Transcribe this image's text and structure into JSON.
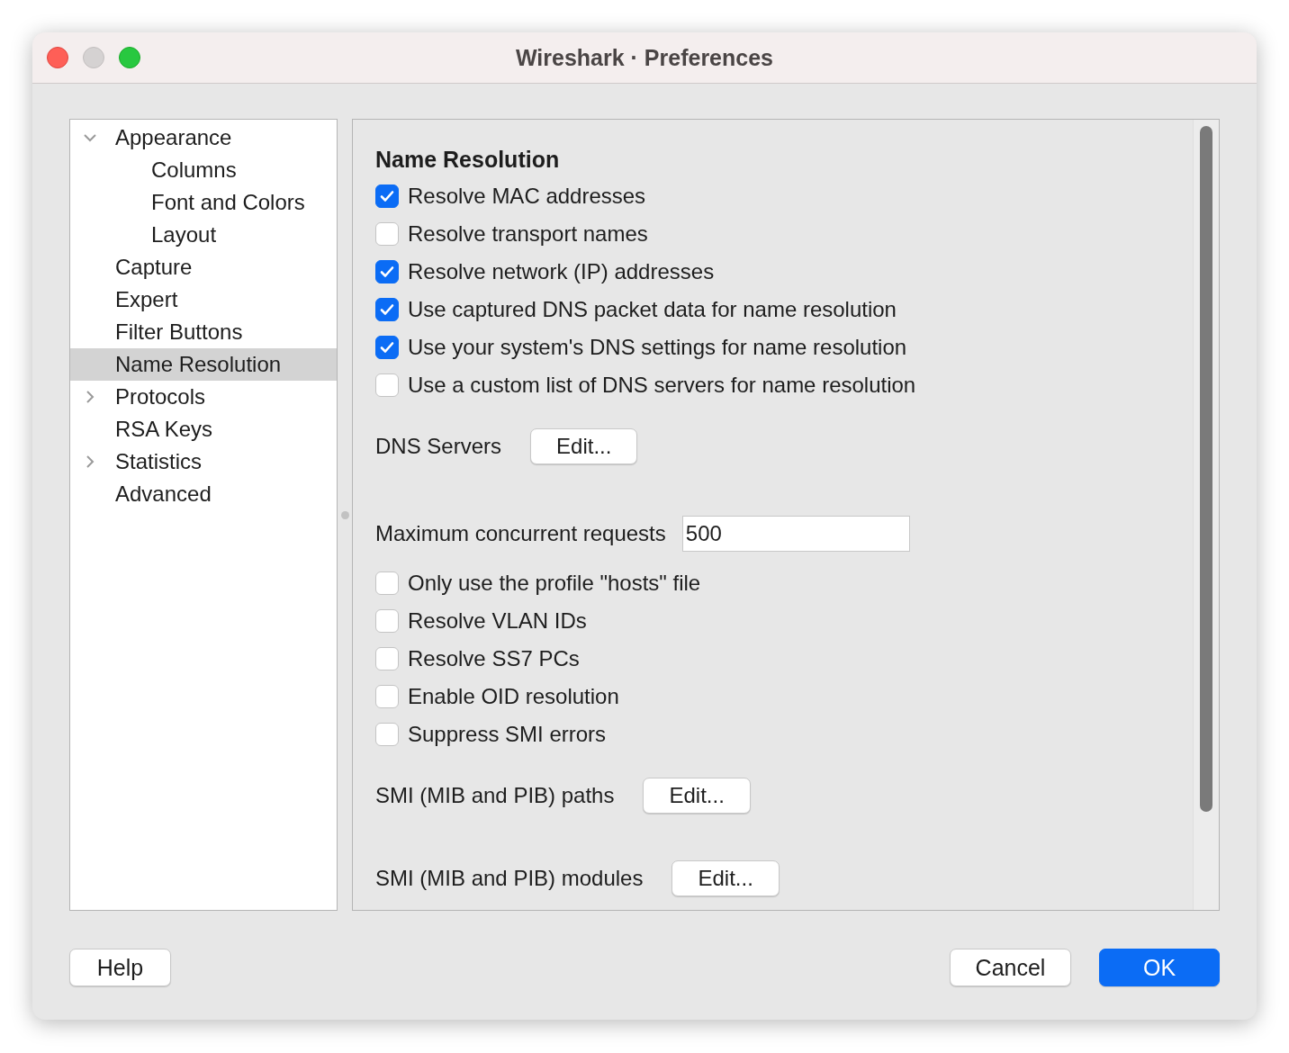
{
  "window": {
    "title": "Wireshark · Preferences"
  },
  "tree": [
    {
      "label": "Appearance",
      "selected": false,
      "expanded": true,
      "children": [
        {
          "label": "Columns",
          "selected": false
        },
        {
          "label": "Font and Colors",
          "selected": false
        },
        {
          "label": "Layout",
          "selected": false
        }
      ]
    },
    {
      "label": "Capture",
      "selected": false
    },
    {
      "label": "Expert",
      "selected": false
    },
    {
      "label": "Filter Buttons",
      "selected": false
    },
    {
      "label": "Name Resolution",
      "selected": true
    },
    {
      "label": "Protocols",
      "selected": false,
      "expanded": false
    },
    {
      "label": "RSA Keys",
      "selected": false
    },
    {
      "label": "Statistics",
      "selected": false,
      "expanded": false
    },
    {
      "label": "Advanced",
      "selected": false
    }
  ],
  "panel": {
    "heading": "Name Resolution",
    "items": [
      {
        "kind": "checkbox",
        "label": "Resolve MAC addresses",
        "checked": true
      },
      {
        "kind": "checkbox",
        "label": "Resolve transport names",
        "checked": false
      },
      {
        "kind": "checkbox",
        "label": "Resolve network (IP) addresses",
        "checked": true
      },
      {
        "kind": "checkbox",
        "label": "Use captured DNS packet data for name resolution",
        "checked": true
      },
      {
        "kind": "checkbox",
        "label": "Use your system's DNS settings for name resolution",
        "checked": true
      },
      {
        "kind": "checkbox",
        "label": "Use a custom list of DNS servers for name resolution",
        "checked": false
      },
      {
        "kind": "button",
        "label": "DNS Servers",
        "button": "Edit..."
      },
      {
        "kind": "field",
        "label": "Maximum concurrent requests",
        "value": "500"
      },
      {
        "kind": "checkbox",
        "label": "Only use the profile \"hosts\" file",
        "checked": false
      },
      {
        "kind": "checkbox",
        "label": "Resolve VLAN IDs",
        "checked": false
      },
      {
        "kind": "checkbox",
        "label": "Resolve SS7 PCs",
        "checked": false
      },
      {
        "kind": "checkbox",
        "label": "Enable OID resolution",
        "checked": false
      },
      {
        "kind": "checkbox",
        "label": "Suppress SMI errors",
        "checked": false
      },
      {
        "kind": "button",
        "label": "SMI (MIB and PIB) paths",
        "button": "Edit..."
      },
      {
        "kind": "button",
        "label": "SMI (MIB and PIB) modules",
        "button": "Edit..."
      }
    ]
  },
  "buttons": {
    "help": "Help",
    "cancel": "Cancel",
    "ok": "OK"
  }
}
